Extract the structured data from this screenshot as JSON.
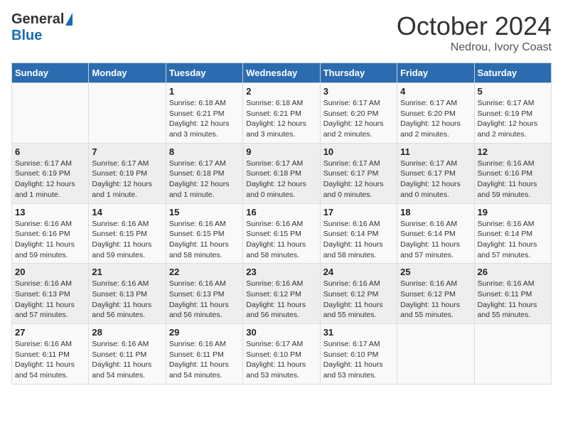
{
  "header": {
    "logo": {
      "general": "General",
      "blue": "Blue"
    },
    "title": "October 2024",
    "subtitle": "Nedrou, Ivory Coast"
  },
  "days_of_week": [
    "Sunday",
    "Monday",
    "Tuesday",
    "Wednesday",
    "Thursday",
    "Friday",
    "Saturday"
  ],
  "weeks": [
    [
      {
        "day": "",
        "info": ""
      },
      {
        "day": "",
        "info": ""
      },
      {
        "day": "1",
        "info": "Sunrise: 6:18 AM\nSunset: 6:21 PM\nDaylight: 12 hours and 3 minutes."
      },
      {
        "day": "2",
        "info": "Sunrise: 6:18 AM\nSunset: 6:21 PM\nDaylight: 12 hours and 3 minutes."
      },
      {
        "day": "3",
        "info": "Sunrise: 6:17 AM\nSunset: 6:20 PM\nDaylight: 12 hours and 2 minutes."
      },
      {
        "day": "4",
        "info": "Sunrise: 6:17 AM\nSunset: 6:20 PM\nDaylight: 12 hours and 2 minutes."
      },
      {
        "day": "5",
        "info": "Sunrise: 6:17 AM\nSunset: 6:19 PM\nDaylight: 12 hours and 2 minutes."
      }
    ],
    [
      {
        "day": "6",
        "info": "Sunrise: 6:17 AM\nSunset: 6:19 PM\nDaylight: 12 hours and 1 minute."
      },
      {
        "day": "7",
        "info": "Sunrise: 6:17 AM\nSunset: 6:19 PM\nDaylight: 12 hours and 1 minute."
      },
      {
        "day": "8",
        "info": "Sunrise: 6:17 AM\nSunset: 6:18 PM\nDaylight: 12 hours and 1 minute."
      },
      {
        "day": "9",
        "info": "Sunrise: 6:17 AM\nSunset: 6:18 PM\nDaylight: 12 hours and 0 minutes."
      },
      {
        "day": "10",
        "info": "Sunrise: 6:17 AM\nSunset: 6:17 PM\nDaylight: 12 hours and 0 minutes."
      },
      {
        "day": "11",
        "info": "Sunrise: 6:17 AM\nSunset: 6:17 PM\nDaylight: 12 hours and 0 minutes."
      },
      {
        "day": "12",
        "info": "Sunrise: 6:16 AM\nSunset: 6:16 PM\nDaylight: 11 hours and 59 minutes."
      }
    ],
    [
      {
        "day": "13",
        "info": "Sunrise: 6:16 AM\nSunset: 6:16 PM\nDaylight: 11 hours and 59 minutes."
      },
      {
        "day": "14",
        "info": "Sunrise: 6:16 AM\nSunset: 6:15 PM\nDaylight: 11 hours and 59 minutes."
      },
      {
        "day": "15",
        "info": "Sunrise: 6:16 AM\nSunset: 6:15 PM\nDaylight: 11 hours and 58 minutes."
      },
      {
        "day": "16",
        "info": "Sunrise: 6:16 AM\nSunset: 6:15 PM\nDaylight: 11 hours and 58 minutes."
      },
      {
        "day": "17",
        "info": "Sunrise: 6:16 AM\nSunset: 6:14 PM\nDaylight: 11 hours and 58 minutes."
      },
      {
        "day": "18",
        "info": "Sunrise: 6:16 AM\nSunset: 6:14 PM\nDaylight: 11 hours and 57 minutes."
      },
      {
        "day": "19",
        "info": "Sunrise: 6:16 AM\nSunset: 6:14 PM\nDaylight: 11 hours and 57 minutes."
      }
    ],
    [
      {
        "day": "20",
        "info": "Sunrise: 6:16 AM\nSunset: 6:13 PM\nDaylight: 11 hours and 57 minutes."
      },
      {
        "day": "21",
        "info": "Sunrise: 6:16 AM\nSunset: 6:13 PM\nDaylight: 11 hours and 56 minutes."
      },
      {
        "day": "22",
        "info": "Sunrise: 6:16 AM\nSunset: 6:13 PM\nDaylight: 11 hours and 56 minutes."
      },
      {
        "day": "23",
        "info": "Sunrise: 6:16 AM\nSunset: 6:12 PM\nDaylight: 11 hours and 56 minutes."
      },
      {
        "day": "24",
        "info": "Sunrise: 6:16 AM\nSunset: 6:12 PM\nDaylight: 11 hours and 55 minutes."
      },
      {
        "day": "25",
        "info": "Sunrise: 6:16 AM\nSunset: 6:12 PM\nDaylight: 11 hours and 55 minutes."
      },
      {
        "day": "26",
        "info": "Sunrise: 6:16 AM\nSunset: 6:11 PM\nDaylight: 11 hours and 55 minutes."
      }
    ],
    [
      {
        "day": "27",
        "info": "Sunrise: 6:16 AM\nSunset: 6:11 PM\nDaylight: 11 hours and 54 minutes."
      },
      {
        "day": "28",
        "info": "Sunrise: 6:16 AM\nSunset: 6:11 PM\nDaylight: 11 hours and 54 minutes."
      },
      {
        "day": "29",
        "info": "Sunrise: 6:16 AM\nSunset: 6:11 PM\nDaylight: 11 hours and 54 minutes."
      },
      {
        "day": "30",
        "info": "Sunrise: 6:17 AM\nSunset: 6:10 PM\nDaylight: 11 hours and 53 minutes."
      },
      {
        "day": "31",
        "info": "Sunrise: 6:17 AM\nSunset: 6:10 PM\nDaylight: 11 hours and 53 minutes."
      },
      {
        "day": "",
        "info": ""
      },
      {
        "day": "",
        "info": ""
      }
    ]
  ]
}
